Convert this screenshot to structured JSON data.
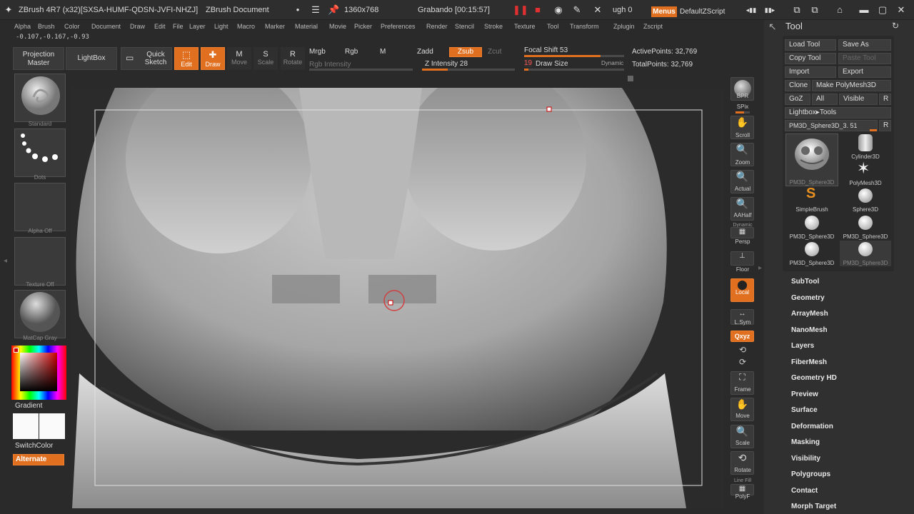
{
  "titlebar": {
    "app": "ZBrush 4R7 (x32)[SXSA-HUMF-QDSN-JVFI-NHZJ]",
    "document": "ZBrush Document",
    "resolution": "1360x768",
    "recording": "Grabando [00:15:57]",
    "brush_info": "ugh  0",
    "menus": "Menus",
    "script": "DefaultZScript"
  },
  "menubar": [
    "Alpha",
    "Brush",
    "Color",
    "Document",
    "Draw",
    "Edit",
    "File",
    "Layer",
    "Light",
    "Macro",
    "Marker",
    "Material",
    "Movie",
    "Picker",
    "Preferences",
    "Render",
    "Stencil",
    "Stroke",
    "Texture",
    "Tool",
    "Transform",
    "Zplugin",
    "Zscript"
  ],
  "coords": "-0.107,-0.167,-0.93",
  "toolbar": {
    "projection_master": "Projection Master",
    "lightbox": "LightBox",
    "quick_sketch": "Quick Sketch",
    "edit": "Edit",
    "draw": "Draw",
    "move": "Move",
    "scale": "Scale",
    "rotate": "Rotate",
    "mrgb": "Mrgb",
    "rgb": "Rgb",
    "m": "M",
    "rgb_intensity": "Rgb Intensity",
    "zadd": "Zadd",
    "zsub": "Zsub",
    "zcut": "Zcut",
    "z_intensity": "Z Intensity 28",
    "z_intensity_value": 28,
    "focal_shift": "Focal Shift 53",
    "focal_shift_value": 53,
    "draw_size_value": "19",
    "draw_size": "Draw Size",
    "dynamic": "Dynamic",
    "active_points": "ActivePoints: 32,769",
    "total_points": "TotalPoints: 32,769"
  },
  "leftshelf": {
    "standard": "Standard",
    "dots": "Dots",
    "alpha_off": "Alpha Off",
    "texture_off": "Texture Off",
    "matcap": "MatCap Gray",
    "gradient": "Gradient",
    "switchcolor": "SwitchColor",
    "alternate": "Alternate"
  },
  "dock": {
    "bpr": "BPR",
    "spix": "SPix",
    "scroll": "Scroll",
    "zoom": "Zoom",
    "actual": "Actual",
    "aahalf": "AAHalf",
    "dynamic": "Dynamic",
    "persp": "Persp",
    "floor": "Floor",
    "local": "Local",
    "lsym": "L.Sym",
    "xyz": "Qxyz",
    "frame": "Frame",
    "move": "Move",
    "scale": "Scale",
    "rotate": "Rotate",
    "linefill": "Line Fill",
    "polyf": "PolyF"
  },
  "toolpanel": {
    "title": "Tool",
    "load_tool": "Load Tool",
    "save_as": "Save As",
    "copy_tool": "Copy Tool",
    "paste_tool": "Paste Tool",
    "import": "Import",
    "export": "Export",
    "clone": "Clone",
    "make_polymesh": "Make PolyMesh3D",
    "goz": "GoZ",
    "all": "All",
    "visible": "Visible",
    "r": "R",
    "lightbox_tools": "Lightbox▸Tools",
    "current_tool": "PM3D_Sphere3D_3. 51",
    "thumbs": [
      "PM3D_Sphere3D",
      "Cylinder3D",
      "PolyMesh3D",
      "SimpleBrush",
      "Sphere3D",
      "PM3D_Sphere3D",
      "PM3D_Sphere3D",
      "PM3D_Sphere3D",
      "PM3D_Sphere3D"
    ],
    "sections": [
      "SubTool",
      "Geometry",
      "ArrayMesh",
      "NanoMesh",
      "Layers",
      "FiberMesh",
      "Geometry HD",
      "Preview",
      "Surface",
      "Deformation",
      "Masking",
      "Visibility",
      "Polygroups",
      "Contact",
      "Morph Target"
    ]
  },
  "colors": {
    "accent": "#e07020",
    "record": "#e03030",
    "panel": "#303030"
  }
}
